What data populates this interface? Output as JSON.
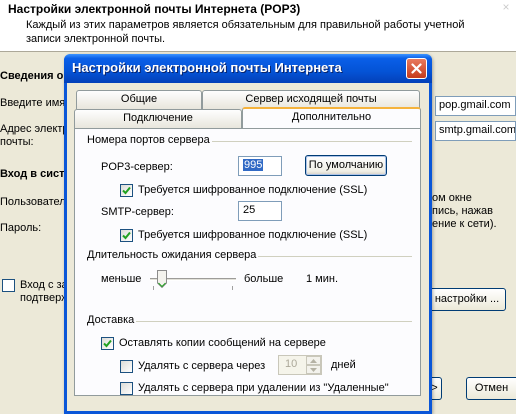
{
  "background_wizard": {
    "title": "Настройки электронной почты Интернета (POP3)",
    "subtitle": "Каждый из этих параметров является обязательным для правильной работы учетной записи электронной почты.",
    "section_info": "Сведения о",
    "label_name": "Введите имя",
    "label_address_1": "Адрес электр",
    "label_address_2": "почты:",
    "section_login": "Вход в сист",
    "label_user": "Пользовател",
    "label_password": "Пароль:",
    "checkbox_spa_1": "Вход с защ",
    "checkbox_spa_2": "подтверж",
    "input_pop_value": "pop.gmail.com",
    "input_smtp_value": "smtp.gmail.com",
    "hint_1": "ом окне",
    "hint_2": "пись, нажав",
    "hint_3": "ение к сети).",
    "more_settings_button": "настройки ...",
    "next_button": ">",
    "cancel_button": "Отмен"
  },
  "dialog": {
    "title": "Настройки электронной почты Интернета",
    "tabs": {
      "general": "Общие",
      "outgoing": "Сервер исходящей почты",
      "connection": "Подключение",
      "advanced": "Дополнительно"
    },
    "ports": {
      "group_title": "Номера портов сервера",
      "pop3_label": "POP3-сервер:",
      "pop3_value": "995",
      "defaults_button": "По умолчанию",
      "pop3_ssl_label": "Требуется шифрованное подключение (SSL)",
      "pop3_ssl_checked": true,
      "smtp_label": "SMTP-сервер:",
      "smtp_value": "25",
      "smtp_ssl_label": "Требуется шифрованное подключение (SSL)",
      "smtp_ssl_checked": true
    },
    "timeout": {
      "group_title": "Длительность ожидания сервера",
      "less_label": "меньше",
      "more_label": "больше",
      "value_label": "1 мин.",
      "level_fraction": 0.1
    },
    "delivery": {
      "group_title": "Доставка",
      "leave_copy_label": "Оставлять копии сообщений на сервере",
      "leave_copy_checked": true,
      "remove_after_label": "Удалять с сервера через",
      "remove_after_checked": false,
      "remove_after_days": "10",
      "days_label": "дней",
      "remove_deleted_label": "Удалять с сервера при удалении из \"Удаленные\"",
      "remove_deleted_checked": false
    }
  },
  "colors": {
    "titlebar": "#0453d6",
    "active_tab_accent": "#f5b33c",
    "close_button": "#c63b1c",
    "checkmark": "#21a121",
    "selection": "#316ac5"
  }
}
